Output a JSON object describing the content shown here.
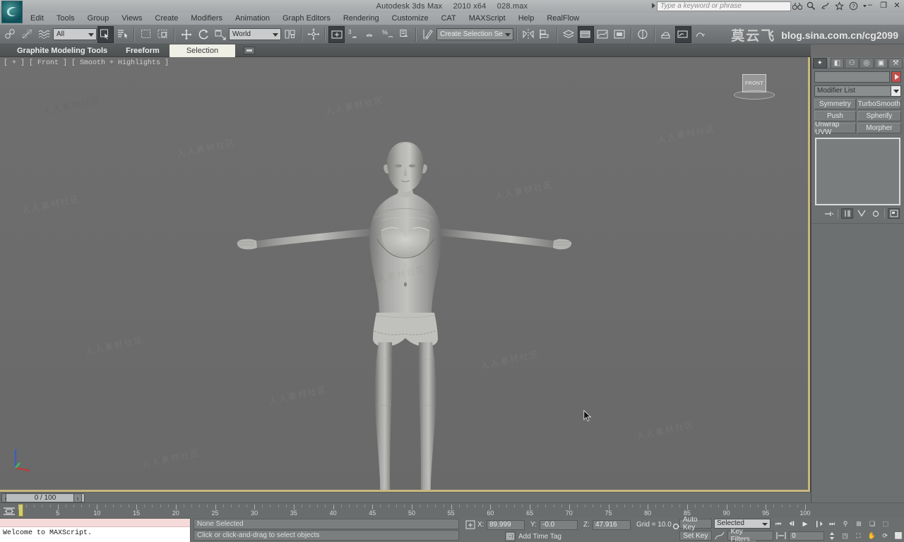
{
  "window": {
    "app_name": "Autodesk 3ds Max",
    "version": "2010 x64",
    "file_name": "028.max",
    "search_placeholder": "Type a keyword or phrase",
    "minimize": "–",
    "maximize": "❐",
    "close": "✕"
  },
  "menu": {
    "items": [
      {
        "label": "Edit"
      },
      {
        "label": "Tools"
      },
      {
        "label": "Group"
      },
      {
        "label": "Views"
      },
      {
        "label": "Create"
      },
      {
        "label": "Modifiers"
      },
      {
        "label": "Animation"
      },
      {
        "label": "Graph Editors"
      },
      {
        "label": "Rendering"
      },
      {
        "label": "Customize"
      },
      {
        "label": "CAT"
      },
      {
        "label": "MAXScript"
      },
      {
        "label": "Help"
      },
      {
        "label": "RealFlow"
      }
    ]
  },
  "toolbar": {
    "selection_filter": "All",
    "reference_coord_system": "World",
    "named_selection_set": "Create Selection Se",
    "snap_percent": "3",
    "icons": [
      "undo-icon",
      "redo-icon",
      "select-link-icon",
      "unlink-icon",
      "bind-space-warp-icon",
      "select-object-icon",
      "select-by-name-icon",
      "rectangular-selection-region-icon",
      "window-crossing-icon",
      "select-and-move-icon",
      "select-and-rotate-icon",
      "select-and-scale-icon",
      "use-center-icon",
      "select-and-manipulate-icon",
      "snaps-toggle-icon",
      "angle-snap-icon",
      "percent-snap-icon",
      "spinner-snap-icon",
      "edit-named-selection-icon",
      "mirror-icon",
      "align-icon",
      "layer-manager-icon",
      "graphite-modeling-icon",
      "curve-editor-icon",
      "schematic-view-icon",
      "material-editor-icon",
      "render-setup-icon",
      "rendered-frame-window-icon",
      "render-production-icon"
    ]
  },
  "watermark": {
    "chinese": "莫云飞",
    "url": "blog.sina.com.cn/cg2099",
    "tile_text": "人人素材社区"
  },
  "ribbon": {
    "tabs": [
      {
        "label": "Graphite Modeling Tools",
        "selected": false
      },
      {
        "label": "Freeform",
        "selected": false
      },
      {
        "label": "Selection",
        "selected": true
      }
    ]
  },
  "viewport": {
    "label": "[ + ] [ Front ] [ Smooth + Highlights ]",
    "viewcube_face": "FRONT",
    "background_color": "#6e6e6e",
    "active_border_color": "#c9b87d"
  },
  "command_panel": {
    "tabs": [
      {
        "name": "create-tab",
        "glyph": "✦",
        "selected": true
      },
      {
        "name": "modify-tab",
        "glyph": "◧",
        "selected": false
      },
      {
        "name": "hierarchy-tab",
        "glyph": "⚇",
        "selected": false
      },
      {
        "name": "motion-tab",
        "glyph": "◎",
        "selected": false
      },
      {
        "name": "display-tab",
        "glyph": "▣",
        "selected": false
      },
      {
        "name": "utilities-tab",
        "glyph": "⚒",
        "selected": false
      }
    ],
    "object_name": "",
    "modifier_list_label": "Modifier List",
    "modifier_buttons": [
      "Symmetry",
      "TurboSmooth",
      "Push",
      "Spherify",
      "Unwrap UVW",
      "Morpher"
    ],
    "stack_toolbar_icons": [
      "pin-stack-icon",
      "show-end-result-icon",
      "make-unique-icon",
      "remove-modifier-icon",
      "configure-modifier-sets-icon"
    ]
  },
  "time_slider": {
    "current_frame_label": "0 / 100",
    "prev_arrow": "‹",
    "next_arrow": "›"
  },
  "track_bar": {
    "range_start": 0,
    "range_end": 100,
    "label_step": 5,
    "labels": [
      5,
      10,
      15,
      20,
      25,
      30,
      35,
      40,
      45,
      50,
      55,
      60,
      65,
      70,
      75,
      80,
      85,
      90,
      95,
      100
    ]
  },
  "status_bar": {
    "maxscript_listener_text": "Welcome to MAXScript.",
    "selection_status": "None Selected",
    "prompt": "Click or click-and-drag to select objects",
    "coord_x_label": "X:",
    "coord_x_value": "89.999",
    "coord_y_label": "Y:",
    "coord_y_value": "-0.0",
    "coord_z_label": "Z:",
    "coord_z_value": "47.916",
    "grid_label": "Grid = 10.0",
    "add_time_tag": "Add Time Tag"
  },
  "animation_controls": {
    "auto_key": "Auto Key",
    "set_key": "Set Key",
    "key_mode": "Selected",
    "key_filters": "Key Filters...",
    "current_frame_value": "0",
    "playback": [
      {
        "name": "go-to-start-button",
        "glyph": "⏮"
      },
      {
        "name": "previous-frame-button",
        "glyph": "⏴❙"
      },
      {
        "name": "play-animation-button",
        "glyph": "▶"
      },
      {
        "name": "next-frame-button",
        "glyph": "❙⏵"
      },
      {
        "name": "go-to-end-button",
        "glyph": "⏭"
      }
    ],
    "view_nav": [
      {
        "name": "zoom-button",
        "glyph": "⚲"
      },
      {
        "name": "zoom-all-button",
        "glyph": "⊞"
      },
      {
        "name": "zoom-extents-button",
        "glyph": "❑"
      },
      {
        "name": "zoom-extents-all-button",
        "glyph": "⬚"
      },
      {
        "name": "field-of-view-button",
        "glyph": "◳"
      },
      {
        "name": "zoom-region-button",
        "glyph": "⛶"
      },
      {
        "name": "pan-view-button",
        "glyph": "✋"
      },
      {
        "name": "orbit-button",
        "glyph": "⟳"
      },
      {
        "name": "maximize-viewport-button",
        "glyph": "⬜"
      }
    ]
  }
}
